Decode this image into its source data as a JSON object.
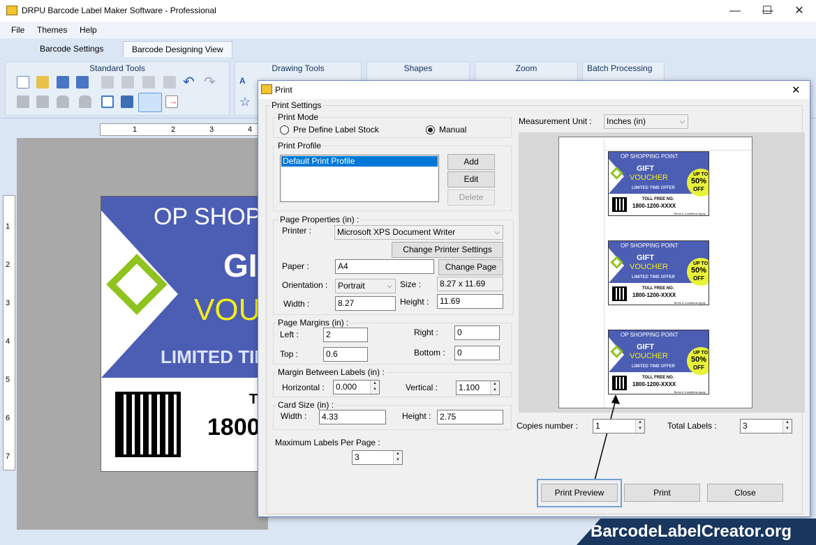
{
  "window": {
    "title": "DRPU Barcode Label Maker Software - Professional",
    "minimize": "—",
    "maximize": "☐",
    "close": "✕"
  },
  "menu": [
    "File",
    "Themes",
    "Help"
  ],
  "tabs": [
    "Barcode Settings",
    "Barcode Designing View"
  ],
  "ribbon": {
    "groups": [
      "Standard Tools",
      "Drawing Tools",
      "Shapes",
      "Zoom",
      "Batch Processing"
    ]
  },
  "ruler": {
    "h": [
      "1",
      "2",
      "3",
      "4"
    ],
    "v": [
      "1",
      "2",
      "3",
      "4",
      "5",
      "6",
      "7"
    ]
  },
  "label": {
    "line1": "OP SHOPPING POINT",
    "line2": "GIFT",
    "line3": "VOUCHER",
    "line4": "LIMITED TIME OFFER",
    "toll_label": "TOLL FREE NO.",
    "phone": "1800-1200-XXXX"
  },
  "dialog": {
    "title": "Print",
    "close_icon": "✕",
    "print_settings": "Print Settings",
    "print_mode": {
      "legend": "Print Mode",
      "option1": "Pre Define Label Stock",
      "option2": "Manual",
      "selected": "Manual"
    },
    "print_profile": {
      "legend": "Print Profile",
      "items": [
        "Default Print Profile"
      ],
      "add": "Add",
      "edit": "Edit",
      "delete": "Delete"
    },
    "page_properties": {
      "legend": "Page Properties (in) :",
      "printer_label": "Printer :",
      "printer": "Microsoft XPS Document Writer",
      "change_printer": "Change Printer Settings",
      "paper_label": "Paper :",
      "paper": "A4",
      "change_page": "Change Page",
      "orientation_label": "Orientation :",
      "orientation": "Portrait",
      "size_label": "Size :",
      "size": "8.27 x 11.69",
      "width_label": "Width :",
      "width": "8.27",
      "height_label": "Height :",
      "height": "11.69"
    },
    "page_margins": {
      "legend": "Page Margins (in) :",
      "left_label": "Left :",
      "left": "2",
      "right_label": "Right :",
      "right": "0",
      "top_label": "Top :",
      "top": "0.6",
      "bottom_label": "Bottom :",
      "bottom": "0"
    },
    "margin_between": {
      "legend": "Margin Between Labels (in) :",
      "horizontal_label": "Horizontal :",
      "horizontal": "0.000",
      "vertical_label": "Vertical :",
      "vertical": "1.100"
    },
    "card_size": {
      "legend": "Card Size (in) :",
      "width_label": "Width :",
      "width": "4.33",
      "height_label": "Height :",
      "height": "2.75"
    },
    "max_labels": {
      "label": "Maximum Labels Per Page :",
      "value": "3"
    },
    "measurement": {
      "label": "Measurement Unit :",
      "value": "Inches (in)"
    },
    "preview_labels": [
      {
        "title": "OP SHOPPING POINT",
        "gift": "GIFT",
        "voucher": "VOUCHER",
        "offer": "LIMITED TIME OFFER",
        "upto": "UP TO",
        "pct": "50%",
        "off": "OFF",
        "toll": "TOLL FREE NO.",
        "phone": "1800-1200-XXXX",
        "terms": "Terms & Conditions Apply"
      },
      {
        "title": "OP SHOPPING POINT",
        "gift": "GIFT",
        "voucher": "VOUCHER",
        "offer": "LIMITED TIME OFFER",
        "upto": "UP TO",
        "pct": "50%",
        "off": "OFF",
        "toll": "TOLL FREE NO.",
        "phone": "1800-1200-XXXX",
        "terms": "Terms & Conditions Apply"
      },
      {
        "title": "OP SHOPPING POINT",
        "gift": "GIFT",
        "voucher": "VOUCHER",
        "offer": "LIMITED TIME OFFER",
        "upto": "UP TO",
        "pct": "50%",
        "off": "OFF",
        "toll": "TOLL FREE NO.",
        "phone": "1800-1200-XXXX",
        "terms": "Terms & Conditions Apply"
      }
    ],
    "copies": {
      "label": "Copies number :",
      "value": "1"
    },
    "total_labels": {
      "label": "Total Labels :",
      "value": "3"
    },
    "buttons": {
      "preview": "Print Preview",
      "print": "Print",
      "close": "Close"
    }
  },
  "watermark": "BarcodeLabelCreator.org"
}
